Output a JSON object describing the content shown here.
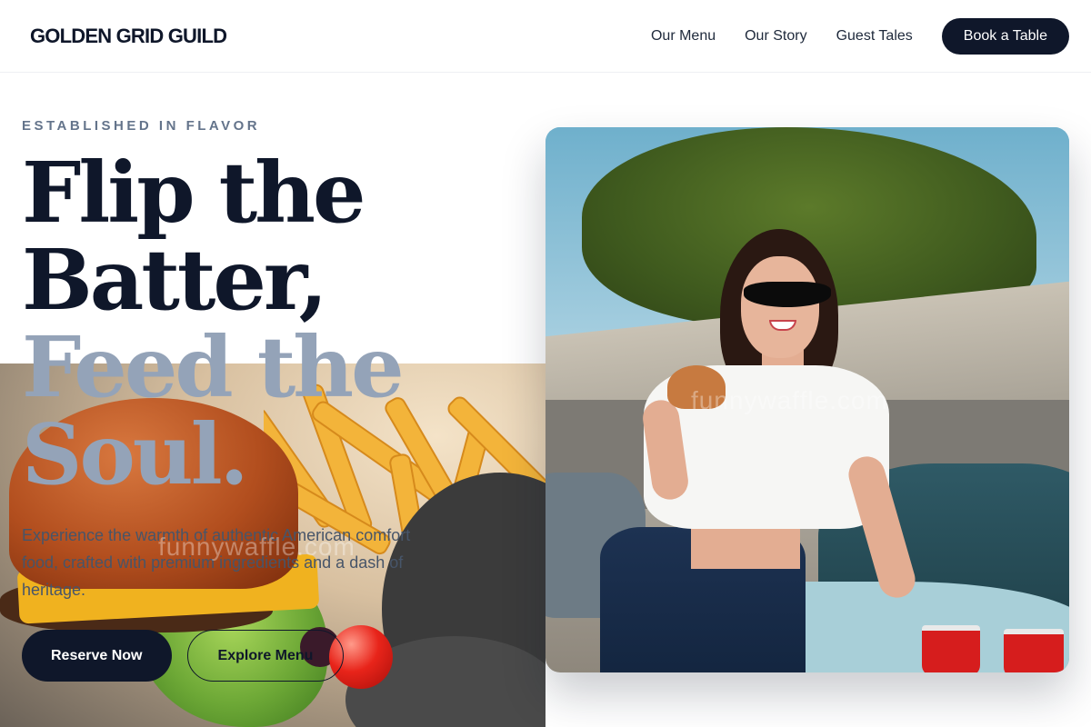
{
  "header": {
    "brand": "GOLDEN GRID GUILD",
    "nav": [
      "Our Menu",
      "Our Story",
      "Guest Tales"
    ],
    "cta": "Book a Table"
  },
  "hero": {
    "eyebrow": "ESTABLISHED IN FLAVOR",
    "headline_dark": [
      "Flip the",
      "Batter,"
    ],
    "headline_light": [
      "Feed the",
      "Soul."
    ],
    "description": "Experience the warmth of authentic American comfort food, crafted with premium ingredients and a dash of heritage.",
    "primary_button": "Reserve Now",
    "secondary_button": "Explore Menu"
  },
  "images": {
    "left_photo": "burger-and-fries-photo",
    "right_photo": "woman-eating-burger-photo",
    "watermark": "funnywaffle.com"
  },
  "colors": {
    "primary": "#0f172a",
    "muted_heading": "#94a3b8",
    "eyebrow": "#64748b",
    "body_text": "#475569"
  }
}
